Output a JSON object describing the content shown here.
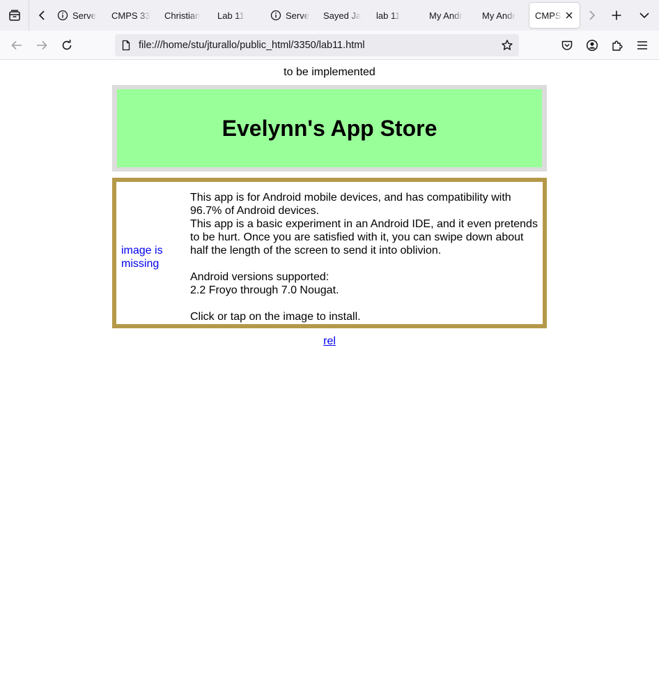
{
  "browser": {
    "tabs": [
      {
        "label": "Serve",
        "has_info_icon": true
      },
      {
        "label": "CMPS 33",
        "has_info_icon": false
      },
      {
        "label": "Christian",
        "has_info_icon": false
      },
      {
        "label": "Lab 11",
        "has_info_icon": false
      },
      {
        "label": "Serve",
        "has_info_icon": true
      },
      {
        "label": "Sayed Ja",
        "has_info_icon": false
      },
      {
        "label": "lab 11",
        "has_info_icon": false
      },
      {
        "label": "My Andr",
        "has_info_icon": false
      },
      {
        "label": "My Andr",
        "has_info_icon": false
      },
      {
        "label": "CMPS",
        "has_info_icon": false,
        "active": true
      }
    ],
    "url": "file:///home/stu/jturallo/public_html/3350/lab11.html",
    "icons": {
      "tab_manager": "tab-manager-icon",
      "scroll_left": "chevron-left-icon",
      "scroll_right": "chevron-right-icon",
      "new_tab": "plus-icon",
      "tab_list": "chevron-down-icon",
      "back": "back-arrow-icon",
      "forward": "forward-arrow-icon",
      "reload": "reload-icon",
      "page": "page-icon",
      "bookmark": "star-icon",
      "pocket": "pocket-icon",
      "account": "account-icon",
      "extensions": "extensions-icon",
      "menu": "hamburger-menu-icon"
    }
  },
  "page": {
    "top_note": "to be implemented",
    "store_title": "Evelynn's App Store",
    "image_alt": "image is missing",
    "description": {
      "line1": "This app is for Android mobile devices, and has compatibility with 96.7% of Android devices.",
      "line2": "This app is a basic experiment in an Android IDE, and it even pretends to be hurt. Once you are satisfied with it, you can swipe down about half the length of the screen to send it into oblivion.",
      "versions_label": "Android versions supported:",
      "versions_value": "2.2 Froyo through 7.0 Nougat.",
      "install_hint": "Click or tap on the image to install."
    },
    "footer_link": "rel"
  },
  "colors": {
    "header_outer": "#dcdcdc",
    "header_inner": "#99ff99",
    "app_border": "#b5994a",
    "link": "#0000ee"
  }
}
